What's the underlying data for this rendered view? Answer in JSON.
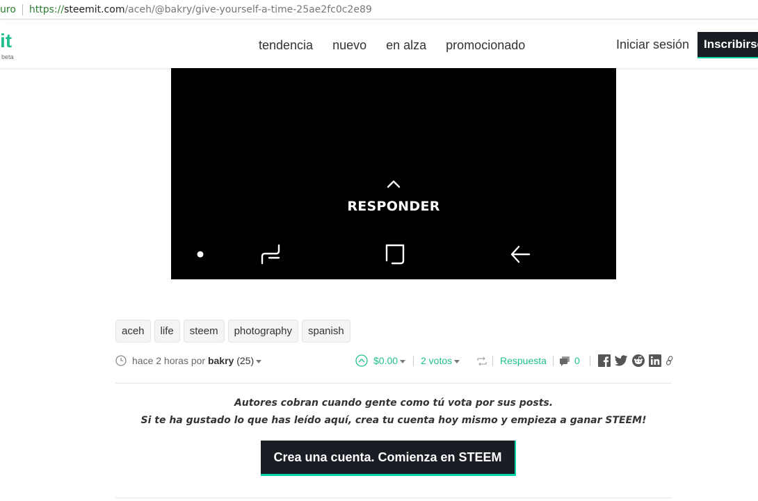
{
  "browser": {
    "security_label": "uro",
    "url_protocol": "https://",
    "url_host": "steemit.com",
    "url_path": "/aceh/@bakry/give-yourself-a-time-25ae2fc0c2e89"
  },
  "header": {
    "logo_text": "it",
    "logo_beta": "beta",
    "nav": [
      "tendencia",
      "nuevo",
      "en alza",
      "promocionado"
    ],
    "login_label": "Iniciar sesión",
    "signup_label": "Inscribirse"
  },
  "post_image": {
    "respond_label": "RESPONDER",
    "icons": [
      "chevron-up-icon",
      "dot-icon",
      "recent-apps-icon",
      "home-square-icon",
      "back-arrow-icon"
    ]
  },
  "tags": [
    "aceh",
    "life",
    "steem",
    "photography",
    "spanish"
  ],
  "meta": {
    "time_text": "hace 2 horas por ",
    "author": "bakry",
    "reputation": " (25)",
    "payout": "$0.00",
    "votes": "2 votos",
    "reply_label": "Respuesta",
    "comment_count": "0",
    "share_icons": [
      "facebook-icon",
      "twitter-icon",
      "reddit-icon",
      "linkedin-icon",
      "link-icon"
    ]
  },
  "promo": {
    "line1": "Autores cobran cuando gente como tú vota por sus posts.",
    "line2": "Si te ha gustado lo que has leído aquí, crea tu cuenta hoy mismo y empieza a ganar STEEM!",
    "cta_label": "Crea una cuenta. Comienza en STEEM"
  },
  "colors": {
    "accent": "#1fbf8f",
    "cta_bg": "#1a1d23",
    "cta_border": "#06d6a9"
  }
}
